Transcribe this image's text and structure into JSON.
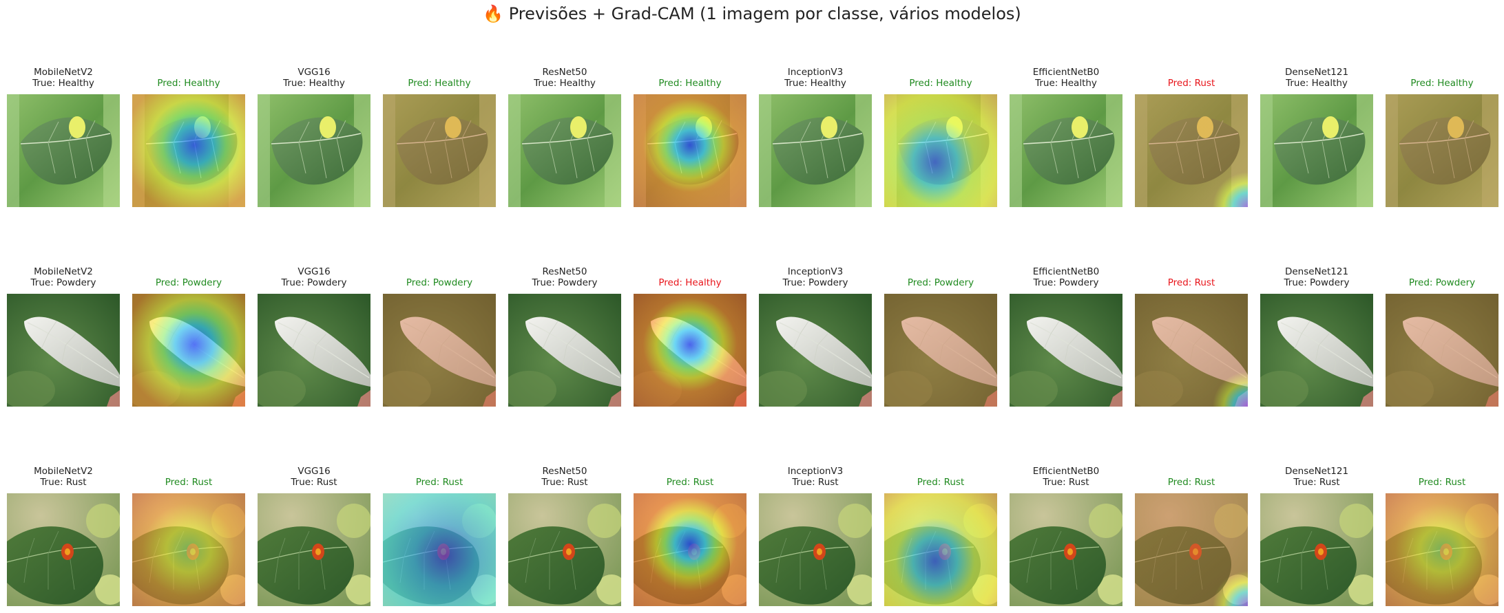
{
  "figure_title": "🔥 Previsões + Grad-CAM (1 imagem por classe, vários modelos)",
  "rows": [
    {
      "leaf_type": "healthy",
      "panels": [
        {
          "model": "MobileNetV2",
          "true_label": "True: Healthy",
          "pred_label": "Pred: Healthy",
          "correct": true,
          "heat": "hot-edges-blue-center"
        },
        {
          "model": "VGG16",
          "true_label": "True: Healthy",
          "pred_label": "Pred: Healthy",
          "correct": true,
          "heat": "warm-tint"
        },
        {
          "model": "ResNet50",
          "true_label": "True: Healthy",
          "pred_label": "Pred: Healthy",
          "correct": true,
          "heat": "ring-blue-center"
        },
        {
          "model": "InceptionV3",
          "true_label": "True: Healthy",
          "pred_label": "Pred: Healthy",
          "correct": true,
          "heat": "yellow-blue-center"
        },
        {
          "model": "EfficientNetB0",
          "true_label": "True: Healthy",
          "pred_label": "Pred: Rust",
          "correct": false,
          "heat": "warm-tint-corner"
        },
        {
          "model": "DenseNet121",
          "true_label": "True: Healthy",
          "pred_label": "Pred: Healthy",
          "correct": true,
          "heat": "warm-tint"
        }
      ]
    },
    {
      "leaf_type": "powdery",
      "panels": [
        {
          "model": "MobileNetV2",
          "true_label": "True: Powdery",
          "pred_label": "Pred: Powdery",
          "correct": true,
          "heat": "hot-edges-blue-center"
        },
        {
          "model": "VGG16",
          "true_label": "True: Powdery",
          "pred_label": "Pred: Powdery",
          "correct": true,
          "heat": "warm-tint"
        },
        {
          "model": "ResNet50",
          "true_label": "True: Powdery",
          "pred_label": "Pred: Healthy",
          "correct": false,
          "heat": "ring-blue-center"
        },
        {
          "model": "InceptionV3",
          "true_label": "True: Powdery",
          "pred_label": "Pred: Powdery",
          "correct": true,
          "heat": "warm-tint"
        },
        {
          "model": "EfficientNetB0",
          "true_label": "True: Powdery",
          "pred_label": "Pred: Rust",
          "correct": false,
          "heat": "warm-tint-corner"
        },
        {
          "model": "DenseNet121",
          "true_label": "True: Powdery",
          "pred_label": "Pred: Powdery",
          "correct": true,
          "heat": "warm-tint"
        }
      ]
    },
    {
      "leaf_type": "rust",
      "panels": [
        {
          "model": "MobileNetV2",
          "true_label": "True: Rust",
          "pred_label": "Pred: Rust",
          "correct": true,
          "heat": "yellow-center"
        },
        {
          "model": "VGG16",
          "true_label": "True: Rust",
          "pred_label": "Pred: Rust",
          "correct": true,
          "heat": "cyan-blue"
        },
        {
          "model": "ResNet50",
          "true_label": "True: Rust",
          "pred_label": "Pred: Rust",
          "correct": true,
          "heat": "ring-blue-center"
        },
        {
          "model": "InceptionV3",
          "true_label": "True: Rust",
          "pred_label": "Pred: Rust",
          "correct": true,
          "heat": "yellow-blue-center"
        },
        {
          "model": "EfficientNetB0",
          "true_label": "True: Rust",
          "pred_label": "Pred: Rust",
          "correct": true,
          "heat": "warm-tint-corner"
        },
        {
          "model": "DenseNet121",
          "true_label": "True: Rust",
          "pred_label": "Pred: Rust",
          "correct": true,
          "heat": "yellow-center"
        }
      ]
    }
  ],
  "colors": {
    "correct": "#1f8a1f",
    "incorrect": "#e8141a"
  }
}
